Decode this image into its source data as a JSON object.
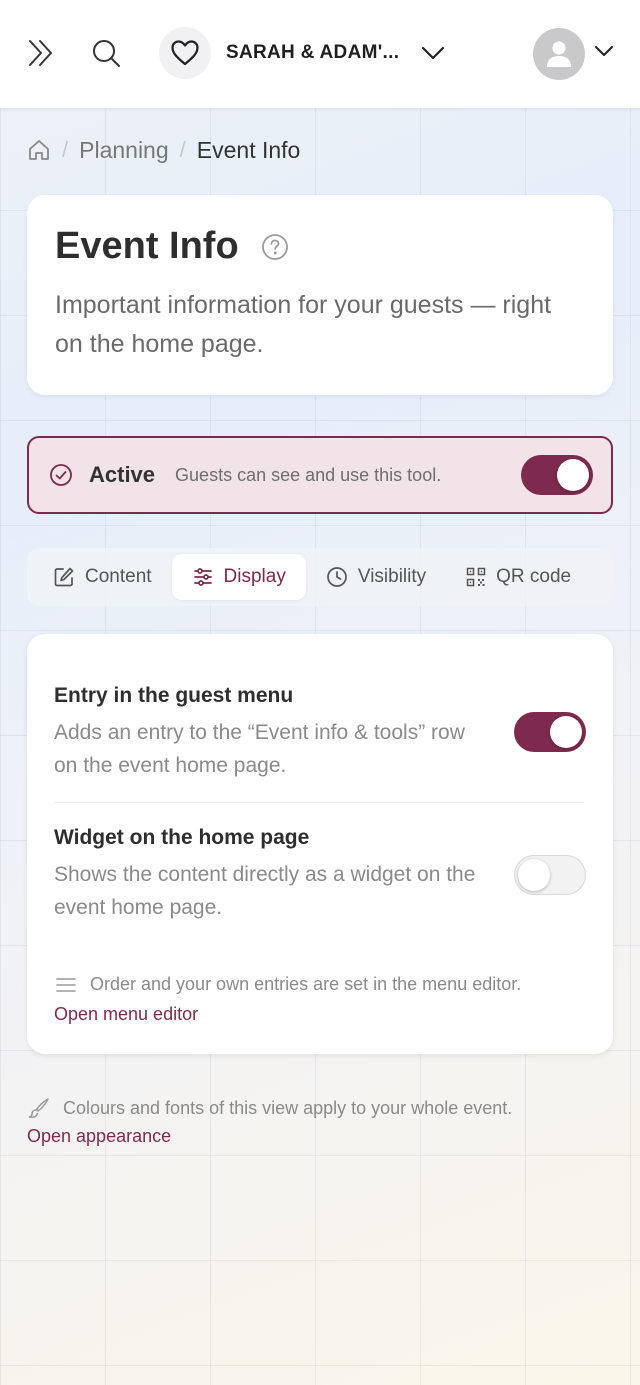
{
  "header": {
    "event_name": "SARAH & ADAM'...",
    "icons": [
      "chevrons-right-icon",
      "search-icon",
      "heart-icon",
      "chevron-down-icon",
      "user-avatar-icon"
    ]
  },
  "breadcrumb": {
    "items": [
      "Planning",
      "Event Info"
    ]
  },
  "page": {
    "title": "Event Info",
    "subtitle": "Important information for your guests — right on the home page."
  },
  "status": {
    "label": "Active",
    "description": "Guests can see and use this tool.",
    "enabled": true
  },
  "tabs": [
    {
      "label": "Content",
      "icon": "edit-icon",
      "active": false
    },
    {
      "label": "Display",
      "icon": "sliders-icon",
      "active": true
    },
    {
      "label": "Visibility",
      "icon": "clock-icon",
      "active": false
    },
    {
      "label": "QR code",
      "icon": "qr-code-icon",
      "active": false
    }
  ],
  "settings": {
    "guest_menu": {
      "title": "Entry in the guest menu",
      "description": "Adds an entry to the “Event info & tools” row on the event home page.",
      "enabled": true
    },
    "home_widget": {
      "title": "Widget on the home page",
      "description": "Shows the content directly as a widget on the event home page.",
      "enabled": false
    },
    "menu_note": "Order and your own entries are set in the menu editor.",
    "menu_link": "Open menu editor"
  },
  "footer": {
    "note": "Colours and fonts of this view apply to your whole event.",
    "link": "Open appearance"
  },
  "colors": {
    "accent": "#7d2a4e",
    "active_bg": "#f1e3e7"
  }
}
